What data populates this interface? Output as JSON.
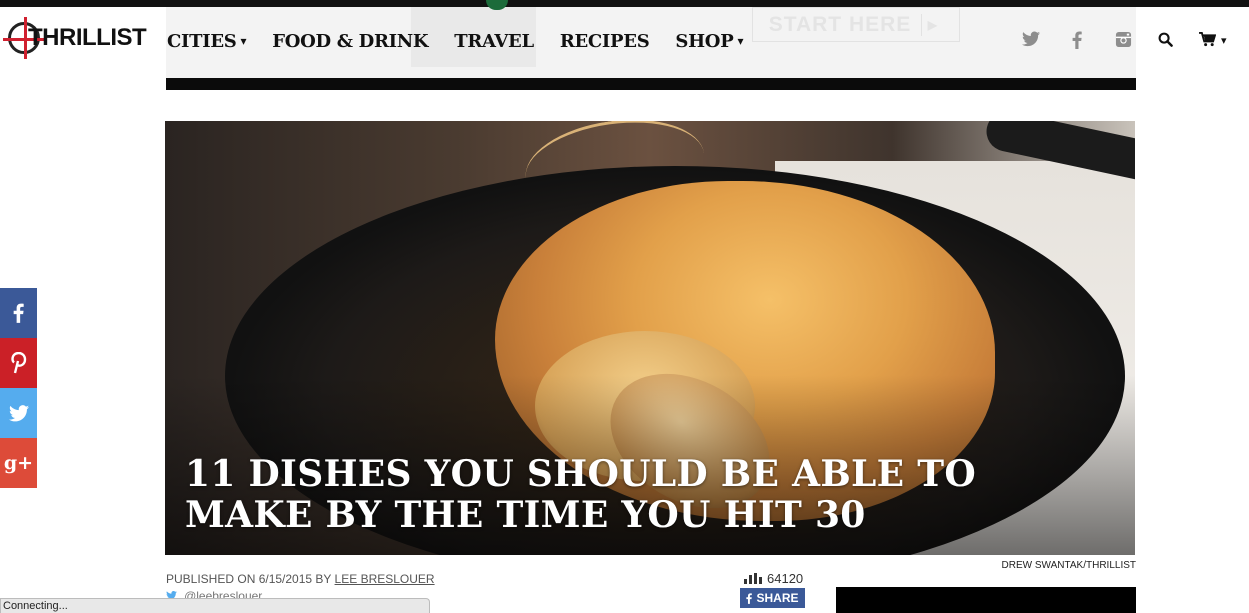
{
  "ad": {
    "cta_label": "START HERE",
    "cta_play_icon": "play-icon"
  },
  "header": {
    "logo_text": "THRILLIST",
    "nav": [
      {
        "label": "CITIES",
        "has_caret": true
      },
      {
        "label": "FOOD & DRINK",
        "has_caret": false
      },
      {
        "label": "TRAVEL",
        "has_caret": false
      },
      {
        "label": "RECIPES",
        "has_caret": false
      },
      {
        "label": "SHOP",
        "has_caret": true
      }
    ],
    "caret_glyph": "▾",
    "social_icons": [
      "twitter-icon",
      "facebook-icon",
      "instagram-icon"
    ],
    "tool_icons": [
      "search-icon",
      "cart-icon"
    ]
  },
  "article": {
    "title": "11 DISHES YOU SHOULD BE ABLE TO MAKE BY THE TIME YOU HIT 30",
    "photo_credit": "DREW SWANTAK/THRILLIST",
    "published_prefix": "PUBLISHED ON 6/15/2015 BY",
    "author": "LEE BRESLOUER",
    "twitter_handle": "@leebreslouer",
    "views": "64120",
    "share_label": "SHARE"
  },
  "share_rail": [
    {
      "icon": "facebook-icon",
      "glyph": "f",
      "color": "#3b5998"
    },
    {
      "icon": "pinterest-icon",
      "glyph": "P",
      "color": "#cb2027"
    },
    {
      "icon": "twitter-icon",
      "glyph": "t",
      "color": "#55acee"
    },
    {
      "icon": "google-plus-icon",
      "glyph": "g+",
      "color": "#dd4b39"
    }
  ],
  "browser_status": "Connecting..."
}
